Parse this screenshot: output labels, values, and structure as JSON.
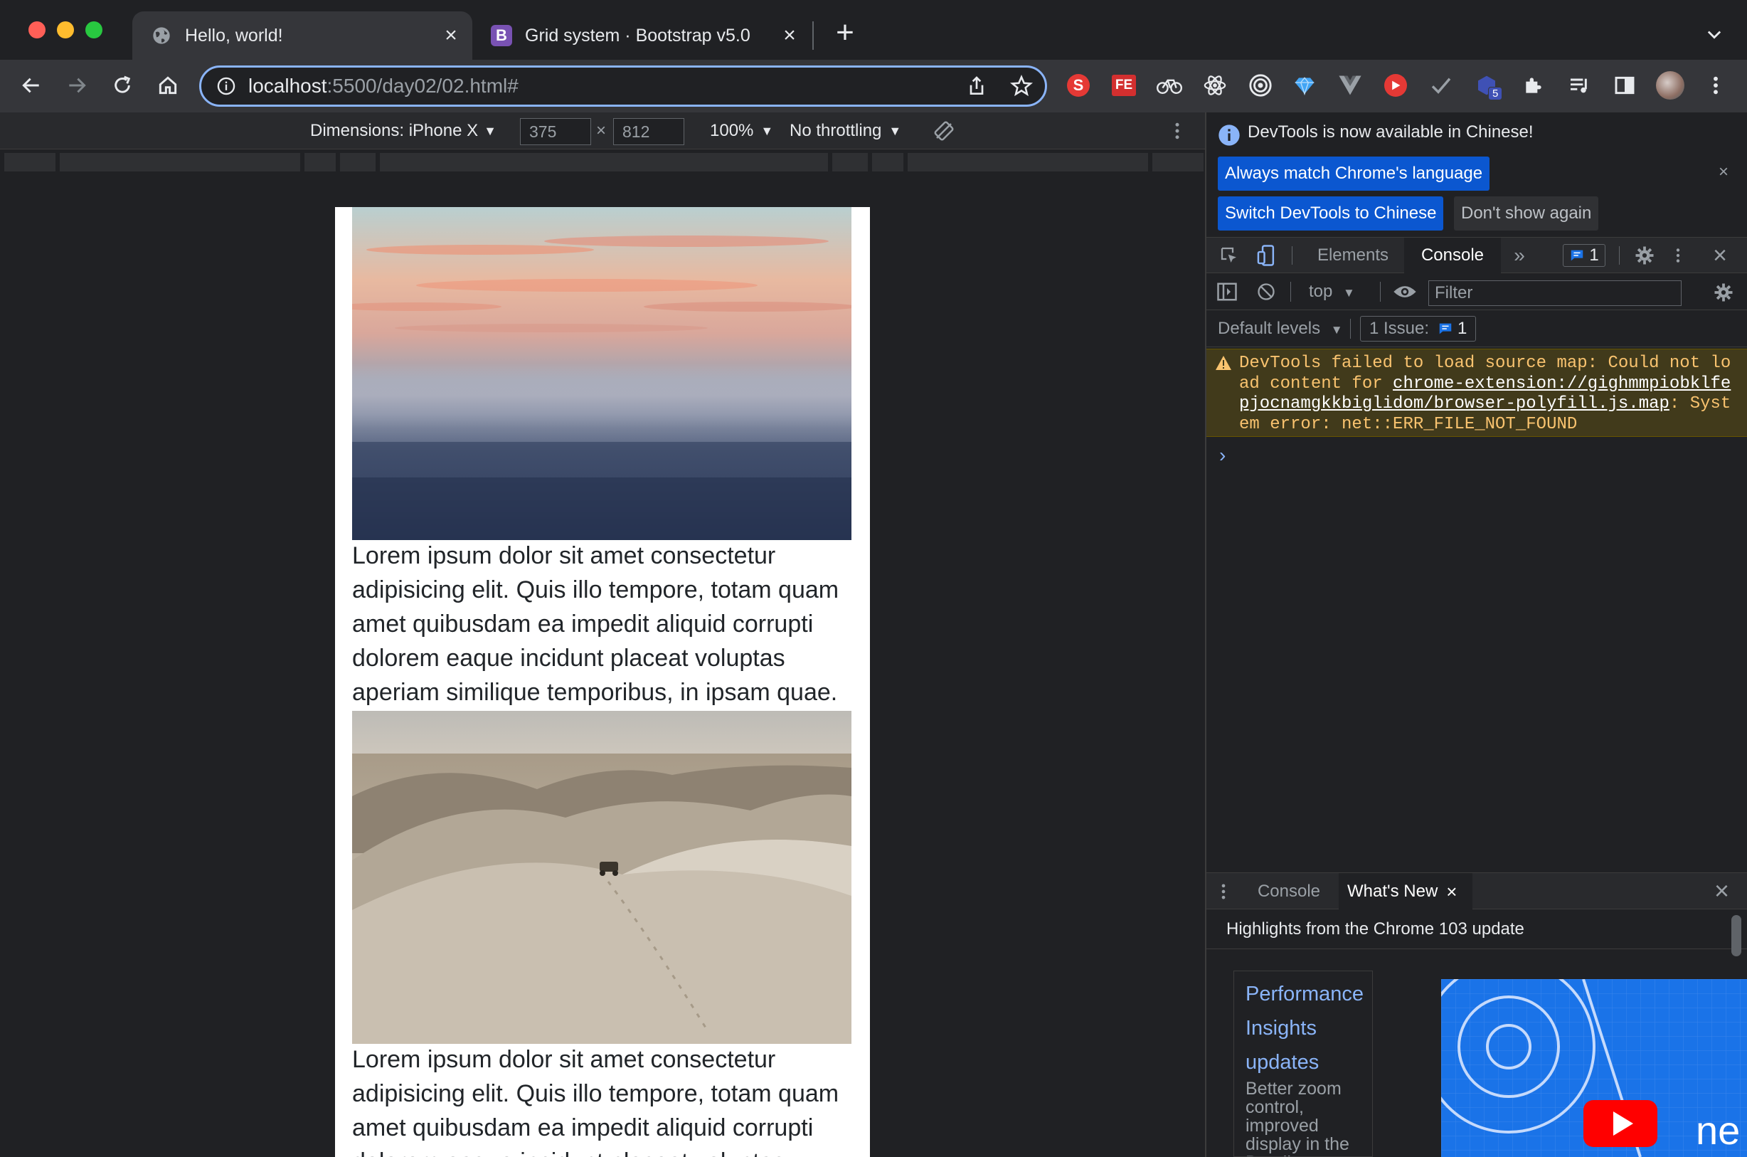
{
  "browser": {
    "tabs": [
      {
        "title": "Hello, world!",
        "icon": "globe-icon",
        "active": true
      },
      {
        "title": "Grid system · Bootstrap v5.0",
        "icon": "bootstrap-icon",
        "active": false
      }
    ],
    "favicon_letter": "B",
    "address": {
      "host": "localhost",
      "path": ":5500/day02/02.html#"
    },
    "extension_badge": "5"
  },
  "device_toolbar": {
    "dimensions_label": "Dimensions: iPhone X",
    "width": "375",
    "height": "812",
    "zoom": "100%",
    "throttling": "No throttling"
  },
  "page": {
    "paragraphs": [
      "Lorem ipsum dolor sit amet consectetur adipisicing elit. Quis illo tempore, totam quam amet quibusdam ea impedit aliquid corrupti dolorem eaque incidunt placeat voluptas aperiam similique temporibus, in ipsam quae.",
      "Lorem ipsum dolor sit amet consectetur adipisicing elit. Quis illo tempore, totam quam amet quibusdam ea impedit aliquid corrupti dolorem eaque incidunt placeat voluptas aperiam similique temporibus, in ipsam quae."
    ]
  },
  "devtools": {
    "banner": {
      "info_text": "DevTools is now available in Chinese!",
      "btn_match": "Always match Chrome's language",
      "btn_switch": "Switch DevTools to Chinese",
      "btn_dont_show": "Don't show again"
    },
    "tabs": {
      "elements": "Elements",
      "console": "Console",
      "issues_count": "1"
    },
    "console": {
      "context": "top",
      "filter_placeholder": "Filter",
      "levels": "Default levels",
      "issues_label": "1 Issue:",
      "issues_count": "1",
      "warning_prefix": "DevTools failed to load source map: Could not load content for ",
      "warning_link": "chrome-extension://gighmmpiobklfepjocnamgkkbiglidom/browser-polyfill.js.map",
      "warning_suffix": ": System error: net::ERR_FILE_NOT_FOUND",
      "prompt": "›"
    },
    "drawer": {
      "tab_console": "Console",
      "tab_whats_new": "What's New",
      "highlights": "Highlights from the Chrome 103 update",
      "card_title": "Performance Insights updates",
      "card_desc": "Better zoom control, improved display in the Details pane"
    }
  }
}
